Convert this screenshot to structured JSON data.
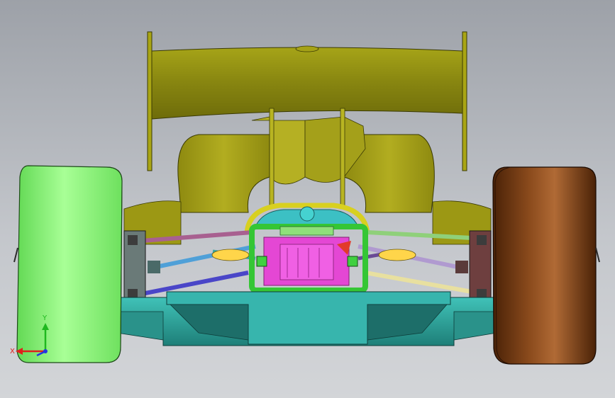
{
  "viewport": {
    "background_top": "#9da1a8",
    "background_bottom": "#d3d5d8"
  },
  "model": {
    "wing_color": "#8c8a10",
    "body_color": "#9a9512",
    "chassis_green": "#3fd43f",
    "pink_block": "#e84fd8",
    "teal_floor": "#2fa8a0",
    "left_wheel": "#8af27a",
    "right_wheel": "#6b3410"
  },
  "triad": {
    "x_label": "X",
    "y_label": "Y",
    "x_color": "#e0201c",
    "y_color": "#1fb81f",
    "z_color": "#2535e0"
  }
}
